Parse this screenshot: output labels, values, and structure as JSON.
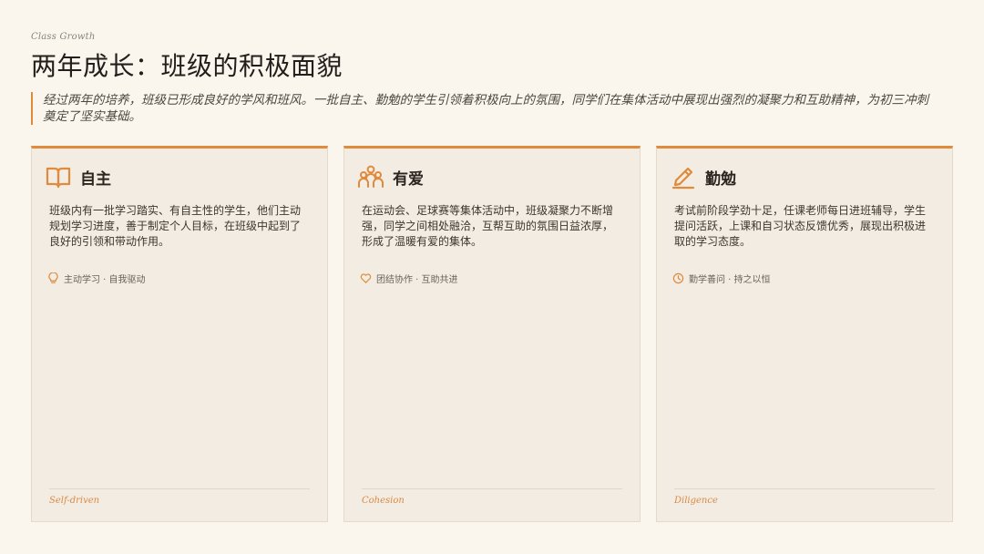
{
  "header": {
    "eyebrow": "Class Growth",
    "title": "两年成长：班级的积极面貌",
    "intro": "经过两年的培养，班级已形成良好的学风和班风。一批自主、勤勉的学生引领着积极向上的氛围，同学们在集体活动中展现出强烈的凝聚力和互助精神，为初三冲刺奠定了坚实基础。"
  },
  "colors": {
    "accent": "#e08a3c",
    "background": "#faf6ee",
    "card": "#f2ece2"
  },
  "cards": [
    {
      "icon": "book-icon",
      "title": "自主",
      "body": "班级内有一批学习踏实、有自主性的学生，他们主动规划学习进度，善于制定个人目标，在班级中起到了良好的引领和带动作用。",
      "tag_icon": "lightbulb-icon",
      "tag": "主动学习 · 自我驱动",
      "en": "Self-driven"
    },
    {
      "icon": "people-icon",
      "title": "有爱",
      "body": "在运动会、足球赛等集体活动中，班级凝聚力不断增强，同学之间相处融洽，互帮互助的氛围日益浓厚，形成了温暖有爱的集体。",
      "tag_icon": "heart-icon",
      "tag": "团结协作 · 互助共进",
      "en": "Cohesion"
    },
    {
      "icon": "pencil-icon",
      "title": "勤勉",
      "body": "考试前阶段学劲十足，任课老师每日进班辅导，学生提问活跃，上课和自习状态反馈优秀，展现出积极进取的学习态度。",
      "tag_icon": "clock-icon",
      "tag": "勤学善问 · 持之以恒",
      "en": "Diligence"
    }
  ]
}
